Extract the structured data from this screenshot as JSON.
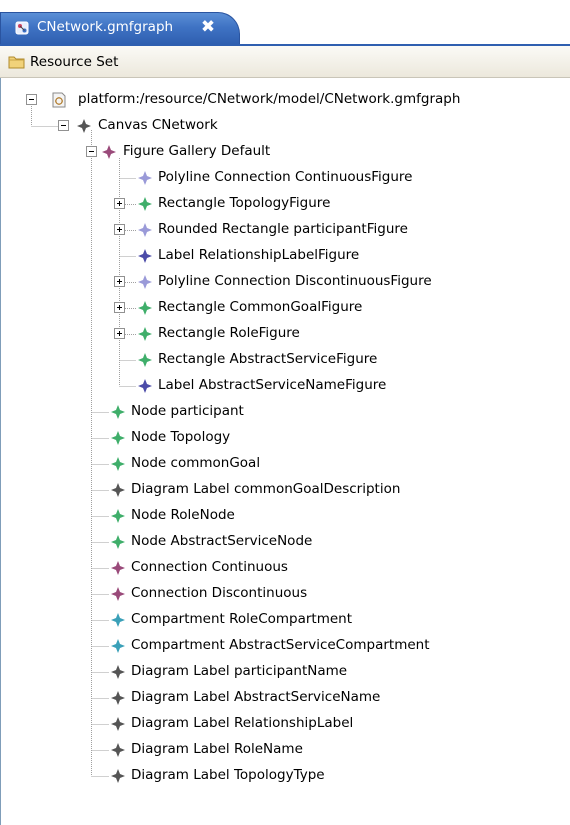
{
  "tab": {
    "title": "CNetwork.gmfgraph",
    "close": "✖"
  },
  "resource_set": {
    "label": "Resource Set"
  },
  "tree": {
    "root": "platform:/resource/CNetwork/model/CNetwork.gmfgraph",
    "canvas": "Canvas CNetwork",
    "gallery": "Figure Gallery Default",
    "figures": [
      {
        "label": "Polyline Connection ContinuousFigure",
        "color": "#9a9ad8",
        "expandable": false
      },
      {
        "label": "Rectangle TopologyFigure",
        "color": "#3fae6a",
        "expandable": true
      },
      {
        "label": "Rounded Rectangle participantFigure",
        "color": "#9a9ad8",
        "expandable": true
      },
      {
        "label": "Label RelationshipLabelFigure",
        "color": "#4b4ba8",
        "expandable": false
      },
      {
        "label": "Polyline Connection DiscontinuousFigure",
        "color": "#9a9ad8",
        "expandable": true
      },
      {
        "label": "Rectangle CommonGoalFigure",
        "color": "#3fae6a",
        "expandable": true
      },
      {
        "label": "Rectangle RoleFigure",
        "color": "#3fae6a",
        "expandable": true
      },
      {
        "label": "Rectangle AbstractServiceFigure",
        "color": "#3fae6a",
        "expandable": false
      },
      {
        "label": "Label AbstractServiceNameFigure",
        "color": "#4b4ba8",
        "expandable": false
      }
    ],
    "elements": [
      {
        "label": "Node participant",
        "color": "#3fae6a"
      },
      {
        "label": "Node Topology",
        "color": "#3fae6a"
      },
      {
        "label": "Node commonGoal",
        "color": "#3fae6a"
      },
      {
        "label": "Diagram Label commonGoalDescription",
        "color": "#555555"
      },
      {
        "label": "Node RoleNode",
        "color": "#3fae6a"
      },
      {
        "label": "Node AbstractServiceNode",
        "color": "#3fae6a"
      },
      {
        "label": "Connection Continuous",
        "color": "#9a4a7a"
      },
      {
        "label": "Connection Discontinuous",
        "color": "#9a4a7a"
      },
      {
        "label": "Compartment RoleCompartment",
        "color": "#3aa0b8"
      },
      {
        "label": "Compartment AbstractServiceCompartment",
        "color": "#3aa0b8"
      },
      {
        "label": "Diagram Label participantName",
        "color": "#555555"
      },
      {
        "label": "Diagram Label AbstractServiceName",
        "color": "#555555"
      },
      {
        "label": "Diagram Label RelationshipLabel",
        "color": "#555555"
      },
      {
        "label": "Diagram Label RoleName",
        "color": "#555555"
      },
      {
        "label": "Diagram Label TopologyType",
        "color": "#555555"
      }
    ],
    "icon_colors": {
      "canvas": "#555555",
      "gallery": "#9a4a7a"
    }
  }
}
